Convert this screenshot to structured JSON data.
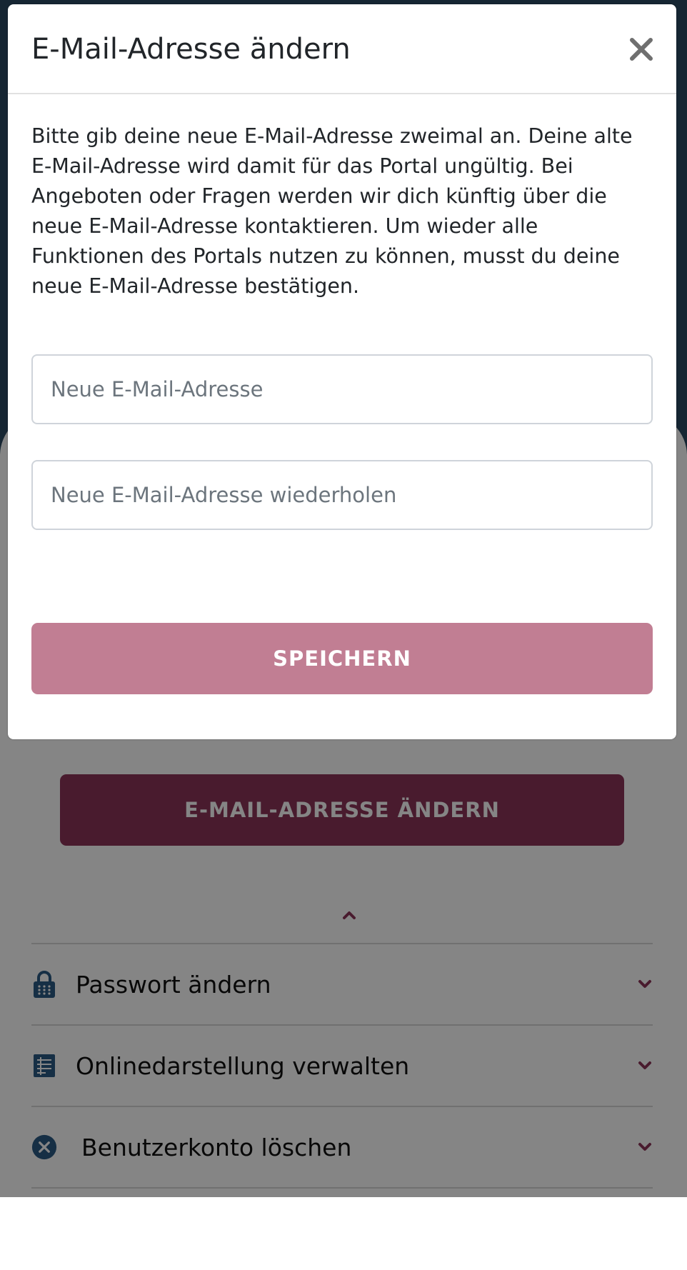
{
  "modal": {
    "title": "E-Mail-Adresse ändern",
    "close_icon": "close-icon",
    "description": "Bitte gib deine neue E-Mail-Adresse zweimal an. Deine alte E-Mail-Adresse wird damit für das Portal ungültig. Bei Angeboten oder Fragen werden wir dich künftig über die neue E-Mail-Adresse kontaktieren. Um wieder alle Funktionen des Portals nutzen zu können, musst du deine neue E-Mail-Adresse bestätigen.",
    "new_email": {
      "value": "",
      "placeholder": "Neue E-Mail-Adresse"
    },
    "repeat_email": {
      "value": "",
      "placeholder": "Neue E-Mail-Adresse wiederholen"
    },
    "save_label": "SPEICHERN"
  },
  "page": {
    "change_email_label": "E-MAIL-ADRESSE ÄNDERN",
    "settings": [
      {
        "label": "Passwort ändern",
        "icon": "lock-icon"
      },
      {
        "label": "Onlinedarstellung verwalten",
        "icon": "list-icon"
      },
      {
        "label": "Benutzerkonto löschen",
        "icon": "delete-circle-icon"
      }
    ]
  },
  "colors": {
    "accent": "#8c3459",
    "accent_disabled": "#c17e93",
    "icon_blue": "#2b5a84",
    "header_band": "#2b4a63"
  }
}
